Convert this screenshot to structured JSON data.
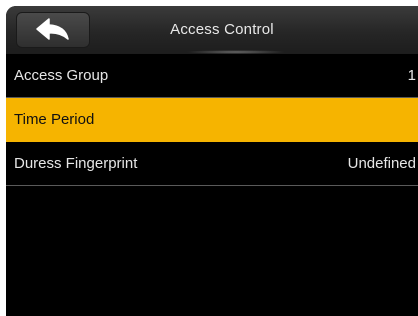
{
  "header": {
    "title": "Access Control",
    "back_icon": "back-arrow-icon"
  },
  "menu": {
    "items": [
      {
        "label": "Access Group",
        "value": "1",
        "selected": false
      },
      {
        "label": "Time Period",
        "value": "",
        "selected": true
      },
      {
        "label": "Duress Fingerprint",
        "value": "Undefined",
        "selected": false
      }
    ]
  },
  "colors": {
    "background": "#000000",
    "highlight": "#f6b400",
    "text": "#e6e6e6",
    "divider": "#5a5a5a"
  }
}
